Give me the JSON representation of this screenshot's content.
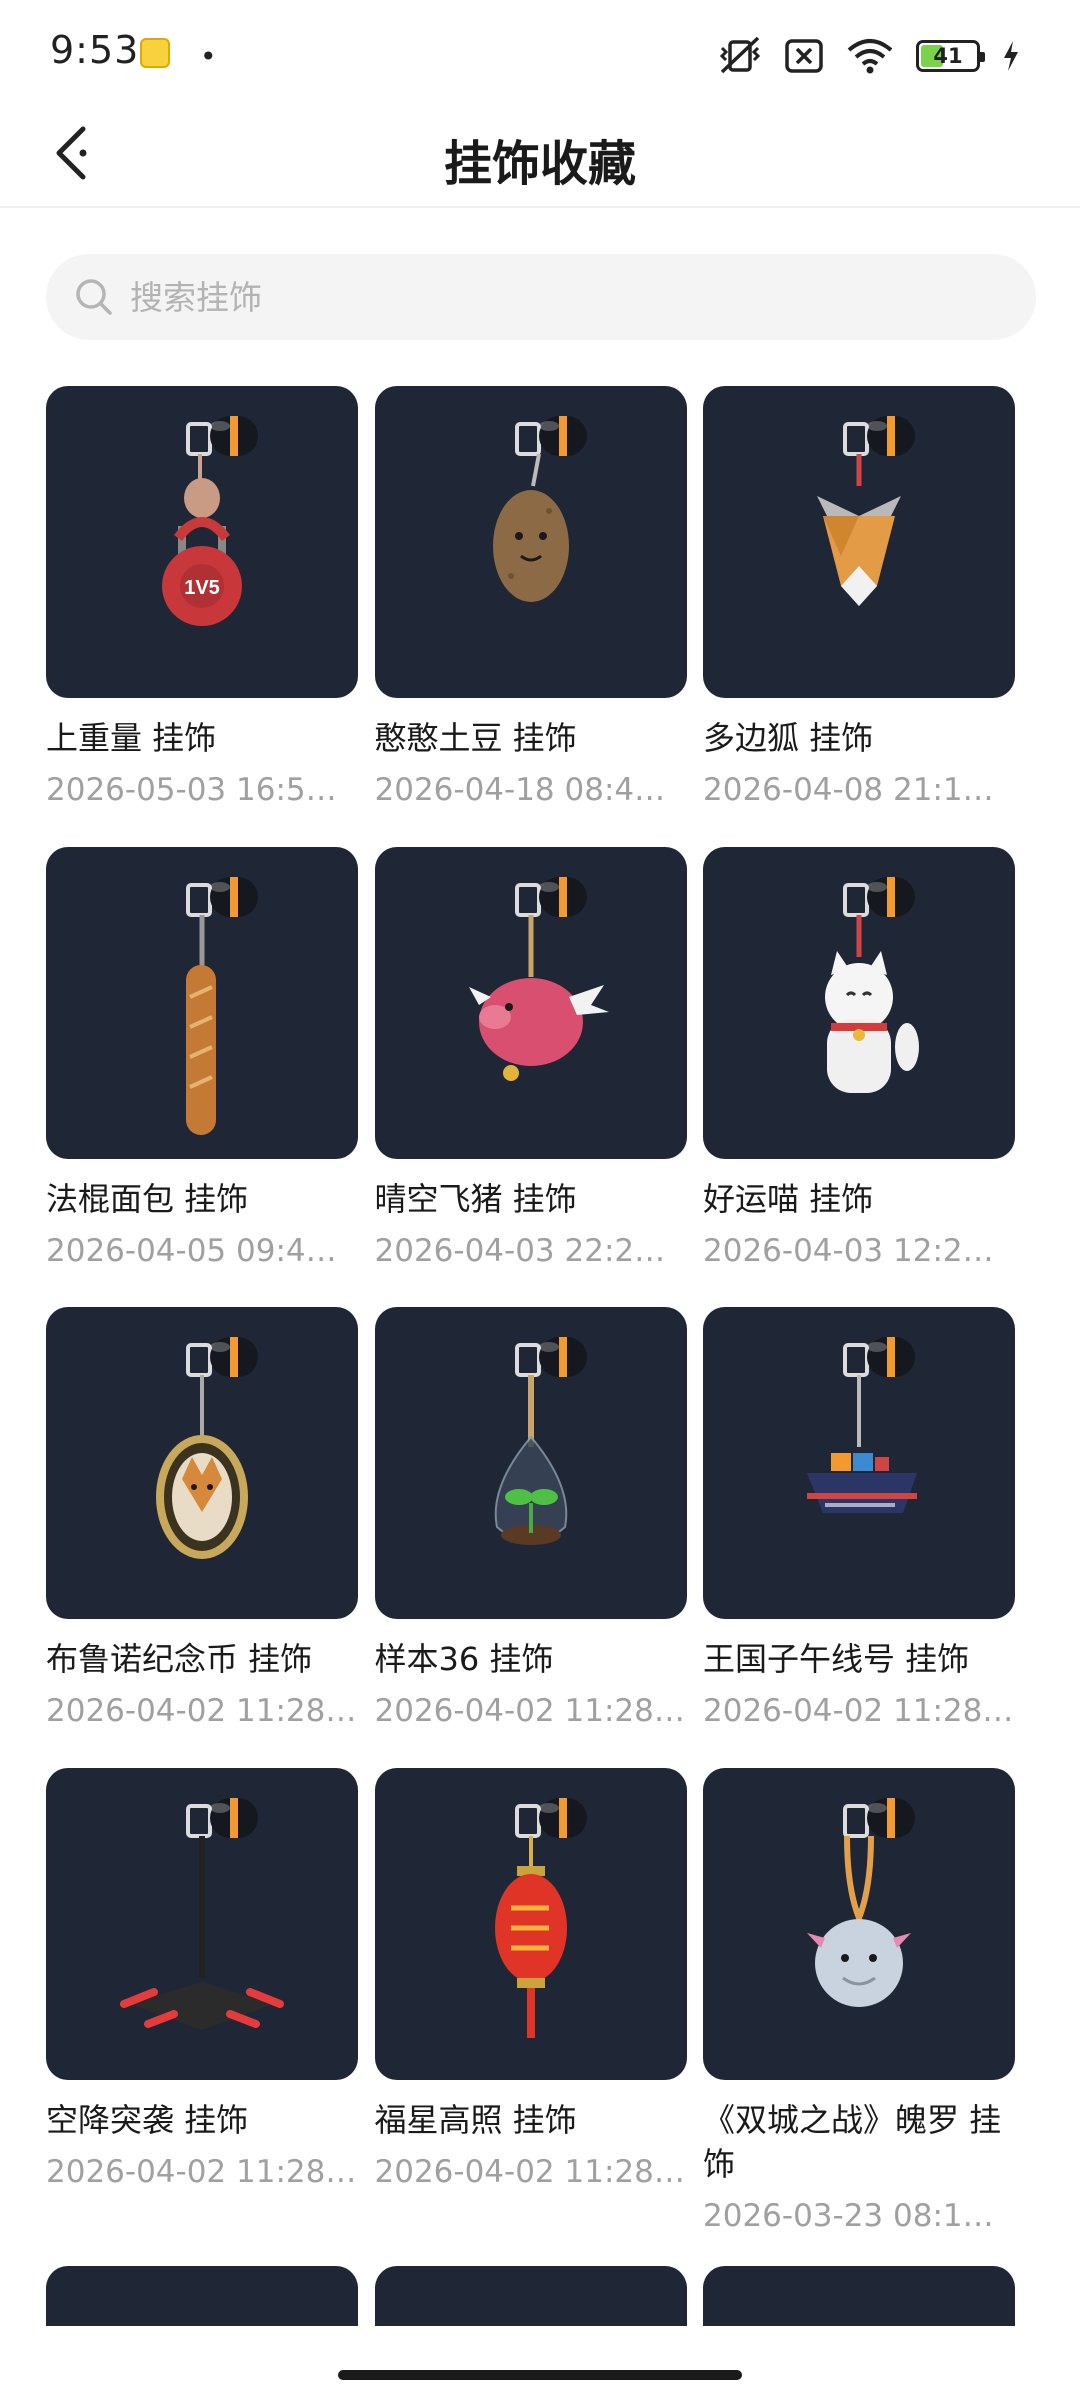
{
  "status_bar": {
    "time": "9:53",
    "battery": "41",
    "battery_level": 0.41,
    "icons": [
      "app-notification-icon",
      "vibrate-off-icon",
      "sim-off-icon",
      "wifi-icon",
      "battery-icon",
      "charging-icon"
    ]
  },
  "header": {
    "title": "挂饰收藏",
    "back_icon": "chevron-left-icon"
  },
  "search": {
    "placeholder": "搜索挂饰",
    "icon": "search-icon"
  },
  "items": [
    {
      "name": " 上重量 挂饰",
      "date": "2026-05-03 16:5…",
      "icon": "kettlebell-charm-icon"
    },
    {
      "name": "憨憨土豆 挂饰",
      "date": "2026-04-18 08:4…",
      "icon": "potato-charm-icon"
    },
    {
      "name": "多边狐 挂饰",
      "date": "2026-04-08 21:1…",
      "icon": "fox-charm-icon"
    },
    {
      "name": "法棍面包 挂饰",
      "date": "2026-04-05 09:4…",
      "icon": "baguette-charm-icon"
    },
    {
      "name": "晴空飞猪 挂饰",
      "date": "2026-04-03 22:2…",
      "icon": "flying-pig-charm-icon"
    },
    {
      "name": "好运喵 挂饰",
      "date": "2026-04-03 12:2…",
      "icon": "lucky-cat-charm-icon"
    },
    {
      "name": "布鲁诺纪念币 挂饰",
      "date": "2026-04-02 11:28…",
      "icon": "coin-charm-icon"
    },
    {
      "name": "样本36 挂饰",
      "date": "2026-04-02 11:28…",
      "icon": "terrarium-charm-icon"
    },
    {
      "name": "王国子午线号 挂饰",
      "date": "2026-04-02 11:28…",
      "icon": "ship-charm-icon"
    },
    {
      "name": "空降突袭 挂饰",
      "date": "2026-04-02 11:28…",
      "icon": "drone-charm-icon"
    },
    {
      "name": "福星高照 挂饰",
      "date": "2026-04-02 11:28…",
      "icon": "lantern-charm-icon"
    },
    {
      "name": "《双城之战》魄罗 挂饰",
      "date": "2026-03-23 08:1…",
      "icon": "poro-charm-icon"
    }
  ],
  "colors": {
    "card_background": "#1f2736",
    "accent_orange": "#f29a2e"
  }
}
